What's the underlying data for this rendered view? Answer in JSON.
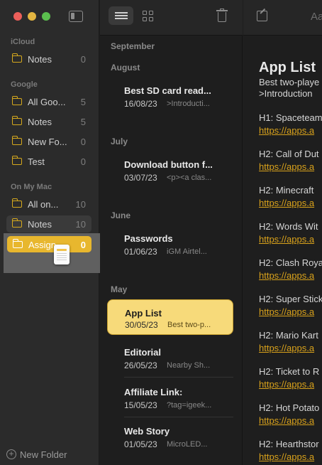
{
  "sidebar": {
    "sections": [
      {
        "label": "iCloud"
      },
      {
        "label": "Google"
      },
      {
        "label": "On My Mac"
      }
    ],
    "folders": {
      "icloud_notes": {
        "name": "Notes",
        "count": "0"
      },
      "all_google": {
        "name": "All Goo...",
        "count": "5"
      },
      "google_notes": {
        "name": "Notes",
        "count": "5"
      },
      "new_folder_google": {
        "name": "New Fo...",
        "count": "0"
      },
      "test": {
        "name": "Test",
        "count": "0"
      },
      "all_on_mac": {
        "name": "All on...",
        "count": "10"
      },
      "mac_notes": {
        "name": "Notes",
        "count": "10"
      },
      "assign": {
        "name": "Assign...",
        "count": "0"
      }
    },
    "new_folder_label": "New Folder"
  },
  "note_list": {
    "months": [
      "September",
      "August",
      "July",
      "June",
      "May"
    ],
    "notes": [
      {
        "title": "Best SD card read...",
        "date": "16/08/23",
        "snippet": ">Introducti..."
      },
      {
        "title": "Download button f...",
        "date": "03/07/23",
        "snippet": "<p><a clas..."
      },
      {
        "title": "Passwords",
        "date": "01/06/23",
        "snippet": "iGM Airtel..."
      },
      {
        "title": "App List",
        "date": "30/05/23",
        "snippet": "Best two-p..."
      },
      {
        "title": "Editorial",
        "date": "26/05/23",
        "snippet": "Nearby Sh..."
      },
      {
        "title": "Affiliate Link:",
        "date": "15/05/23",
        "snippet": "?tag=igeek..."
      },
      {
        "title": "Web Story",
        "date": "01/05/23",
        "snippet": "MicroLED..."
      }
    ]
  },
  "editor": {
    "toolbar_text": "Aa",
    "title": "App List",
    "intro_line1": "Best two-playe",
    "intro_line2": ">Introduction",
    "entries": [
      {
        "heading": "H1: Spaceteam",
        "link": "https://apps.a"
      },
      {
        "heading": "H2: Call of Dut",
        "link": "https://apps.a"
      },
      {
        "heading": "H2: Minecraft",
        "link": "https://apps.a"
      },
      {
        "heading": "H2: Words Wit",
        "link": "https://apps.a"
      },
      {
        "heading": "H2: Clash Roya",
        "link": "https://apps.a"
      },
      {
        "heading": "H2: Super Stick",
        "link": "https://apps.a"
      },
      {
        "heading": "H2: Mario Kart",
        "link": "https://apps.a"
      },
      {
        "heading": "H2: Ticket to R",
        "link": "https://apps.a"
      },
      {
        "heading": "H2: Hot Potato",
        "link": "https://apps.a"
      },
      {
        "heading": "H2: Hearthstor",
        "link": "https://apps.a"
      }
    ]
  },
  "colors": {
    "accent": "#e8b72e",
    "selected_note": "#f7da7a",
    "link": "#d9a21b"
  }
}
